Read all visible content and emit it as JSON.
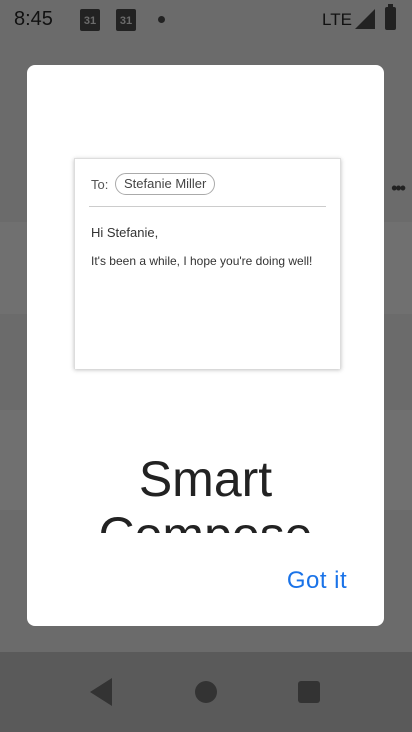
{
  "status_bar": {
    "time": "8:45",
    "calendar_day_1": "31",
    "calendar_day_2": "31",
    "network": "LTE"
  },
  "dialog": {
    "email_preview": {
      "to_label": "To:",
      "recipient": "Stefanie Miller",
      "greeting": "Hi Stefanie,",
      "body": "It's been a while, I hope you're doing well!"
    },
    "title_line1": "Smart",
    "title_line2": "Compose",
    "confirm_label": "Got it"
  },
  "colors": {
    "accent": "#1a73e8",
    "scrim": "#6b6b6b"
  }
}
